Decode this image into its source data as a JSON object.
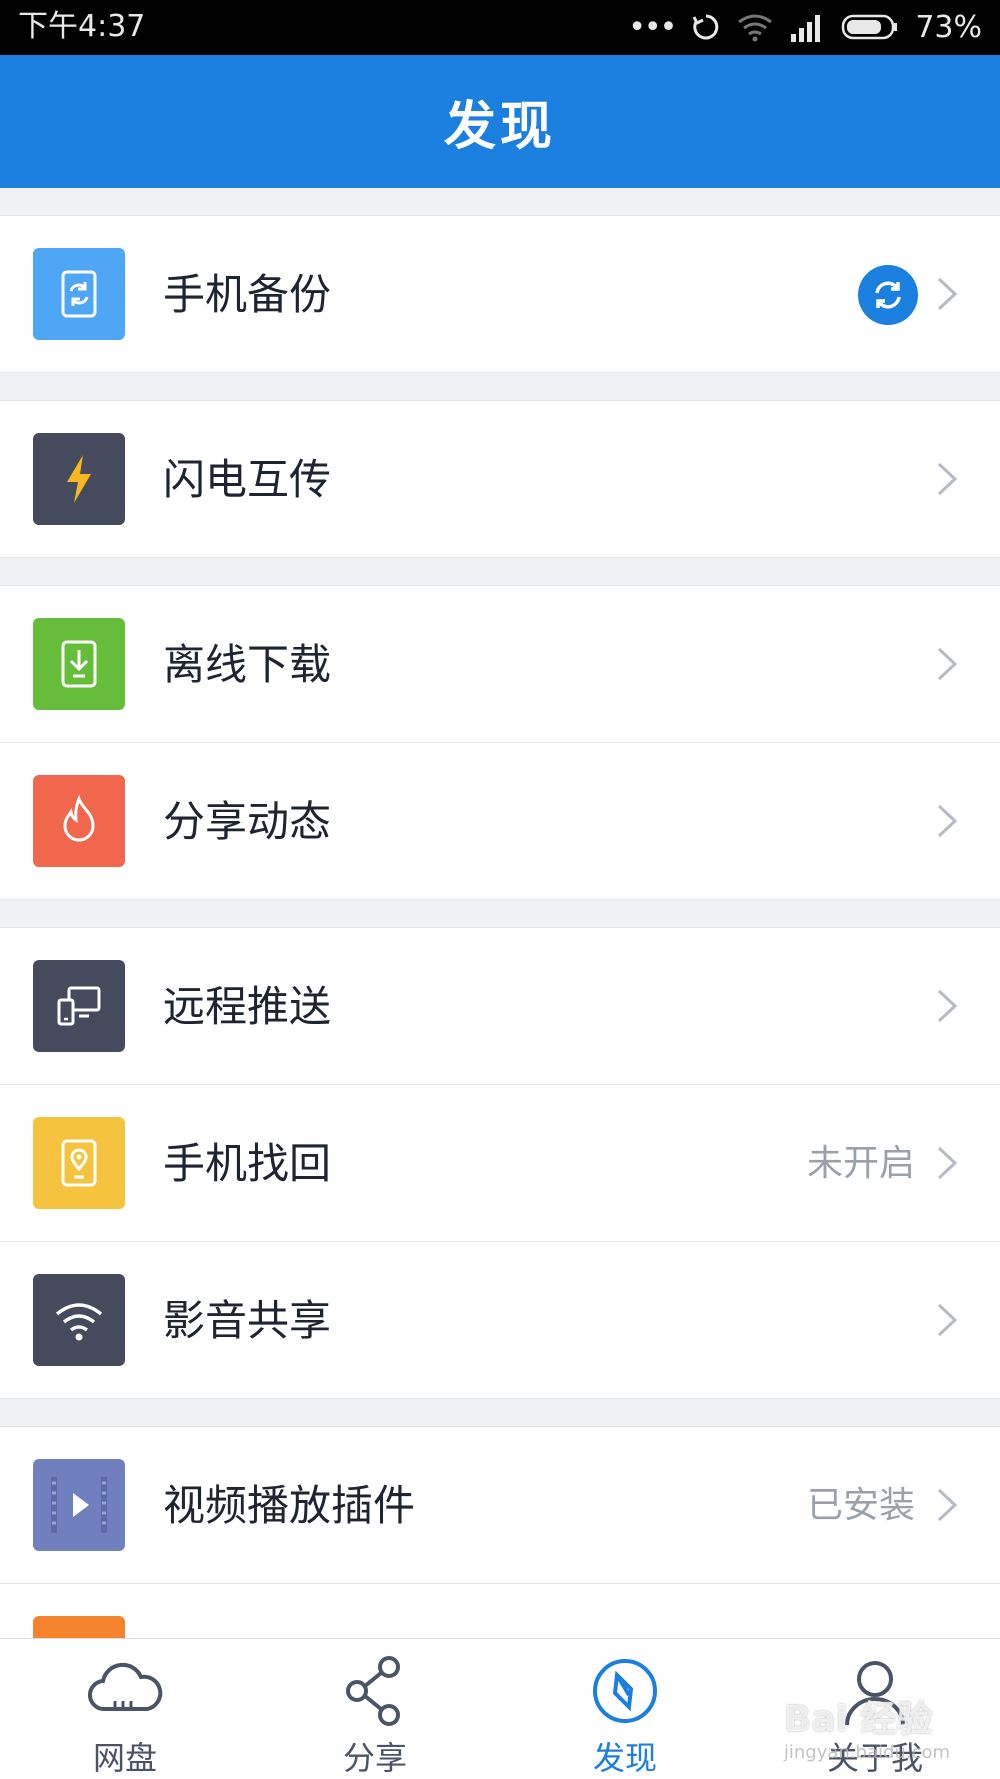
{
  "status_bar": {
    "time": "下午4:37",
    "battery": "73%"
  },
  "nav": {
    "title": "发现"
  },
  "rows": [
    {
      "label": "手机备份",
      "icon": "phone-backup-icon",
      "color": "#4ea6f5",
      "status": ""
    },
    {
      "label": "闪电互传",
      "icon": "lightning-icon",
      "color": "#454a5c",
      "status": ""
    },
    {
      "label": "离线下载",
      "icon": "download-icon",
      "color": "#66bd3a",
      "status": ""
    },
    {
      "label": "分享动态",
      "icon": "flame-icon",
      "color": "#f0674e",
      "status": ""
    },
    {
      "label": "远程推送",
      "icon": "devices-icon",
      "color": "#454a5c",
      "status": ""
    },
    {
      "label": "手机找回",
      "icon": "phone-locate-icon",
      "color": "#f5c33d",
      "status": "未开启"
    },
    {
      "label": "影音共享",
      "icon": "wifi-icon",
      "color": "#454a5c",
      "status": ""
    },
    {
      "label": "视频播放插件",
      "icon": "video-play-icon",
      "color": "#7080bf",
      "status": "已安装"
    }
  ],
  "tabs": [
    {
      "label": "网盘",
      "icon": "cloud-icon"
    },
    {
      "label": "分享",
      "icon": "share-icon"
    },
    {
      "label": "发现",
      "icon": "compass-icon",
      "active": true
    },
    {
      "label": "关于我",
      "icon": "user-icon"
    }
  ],
  "watermark": {
    "brand": "Bai 经验",
    "url": "jingyan.baidu.com"
  },
  "colors": {
    "accent": "#1b7fe0",
    "background": "#eff1f4"
  }
}
